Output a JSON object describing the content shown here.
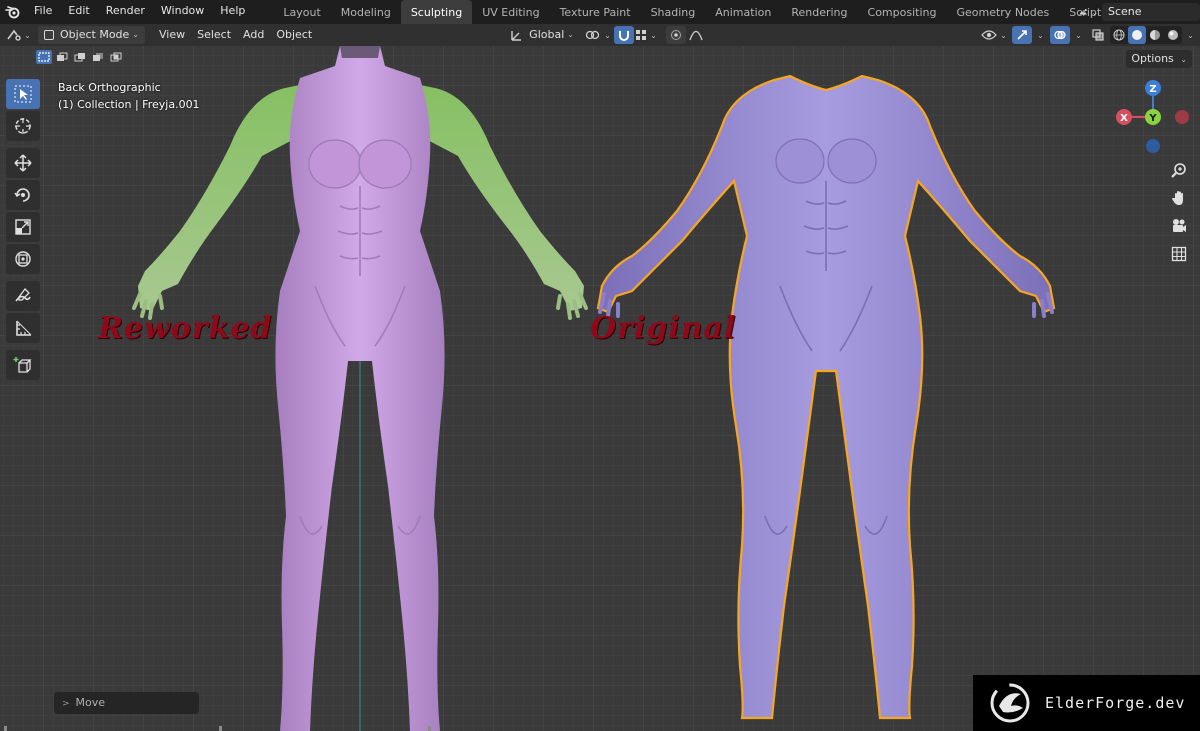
{
  "menu": {
    "items": [
      "File",
      "Edit",
      "Render",
      "Window",
      "Help"
    ]
  },
  "workspaces": {
    "tabs": [
      "Layout",
      "Modeling",
      "Sculpting",
      "UV Editing",
      "Texture Paint",
      "Shading",
      "Animation",
      "Rendering",
      "Compositing",
      "Geometry Nodes",
      "Scripting"
    ],
    "active": "Sculpting",
    "add_label": "+"
  },
  "scene": {
    "label": "Scene"
  },
  "header": {
    "mode": "Object Mode",
    "menus": [
      "View",
      "Select",
      "Add",
      "Object"
    ],
    "transform_orientation": "Global"
  },
  "viewport": {
    "view_name": "Back Orthographic",
    "collection_info": "(1) Collection | Freyja.001",
    "options_label": "Options",
    "last_operator": "Move",
    "gizmo": {
      "x": "X",
      "y": "Y",
      "z": "Z"
    }
  },
  "annotations": {
    "left": "Reworked",
    "right": "Original"
  },
  "watermark": {
    "text": "ElderForge.dev"
  },
  "colors": {
    "accent": "#4772b3",
    "reworked_body": "#c79ae0",
    "reworked_arms": "#8ec56a",
    "original_body": "#9c8fd8",
    "selection_outline": "#f5a623",
    "label_red": "#8e0a1a"
  }
}
